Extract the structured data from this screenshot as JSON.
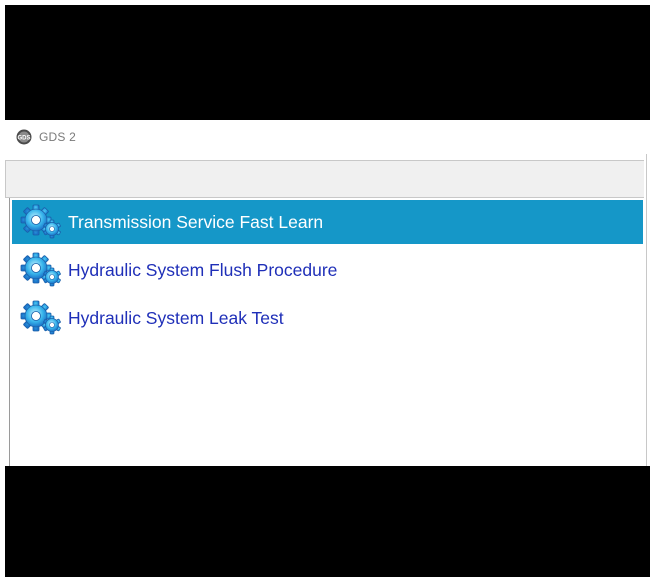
{
  "window": {
    "title": "GDS 2",
    "app_icon": "gds-logo-icon"
  },
  "procedures": {
    "items": [
      {
        "label": "Transmission Service Fast Learn",
        "icon": "gear-icon",
        "selected": true
      },
      {
        "label": "Hydraulic System Flush Procedure",
        "icon": "gear-icon",
        "selected": false
      },
      {
        "label": "Hydraulic System Leak Test",
        "icon": "gear-icon",
        "selected": false
      }
    ]
  },
  "colors": {
    "selection": "#1597c8",
    "link_text": "#1f2fb8",
    "selected_text": "#ffffff",
    "frame": "#000000"
  }
}
